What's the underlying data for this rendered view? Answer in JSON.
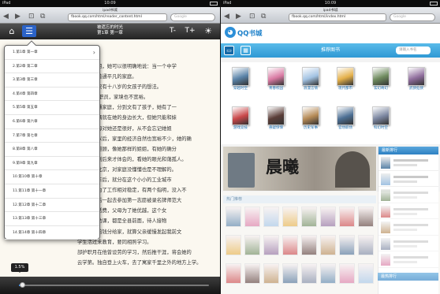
{
  "left": {
    "status": {
      "carrier": "iPad",
      "time": "10:09"
    },
    "browser": {
      "title": "ipad书城",
      "url": "fbook.qq.com/html/reader_content.html",
      "search_placeholder": "Google",
      "back": "◀",
      "forward": "▶",
      "bookmark": "⊡",
      "tabs": "⧉"
    },
    "reader": {
      "book_title": "被遗忘的时光",
      "chapter_title": "第1章 第一章",
      "font_small": "T-",
      "font_large": "T+",
      "progress_label": "1.5%",
      "progress_value": 0.015
    },
    "chapters": [
      "1.第1章 第一章",
      "2.第2章 第二章",
      "3.第3章 第三章",
      "4.第4章 第四章",
      "5.第5章 第五章",
      "6.第6章 第六章",
      "7.第7章 第七章",
      "8.第8章 第八章",
      "9.第9章 第九章",
      "10.第10章 第十章",
      "11.第11章 第十一章",
      "12.第12章 第十二章",
      "13.第13章 第十三章",
      "14.第14章 第十四章"
    ],
    "text_lines": [
      "是我的姐姐，她可以很明确地说：当一个中学",
      "立一个极普通平凡的家庭。",
      "仍是一个只有十八岁的女孩子的想法。",
      "是 名普通职员，家境也不宽裕。",
      "同一个普通家庭，分到文有了孩子，她有了一",
      "来，妹妹俩就在她的身边长大，但她只能和妹",
      "一个，父母对她还是很好，从不会忘记她姐",
      "妹妹出嫁以后，家里的经济自然也宽裕不少，她的确",
      "到更多的照顾，像她那样的姐姐，有她的确分",
      "多年了，到后来才体会的，看她的眼光和蔼孤人。",
      "被遗忘在北京，对家庭没懂懂也是不理解的。",
      "点，四五年后，就分在这个小小的工业城市",
      "不住了，为了工作相对稳定，有两个指明，没入不",
      "高考时过后一起去参加第一志愿被录名牌师范大",
      "学参，生活费，父母为了她优越，这个女",
      "常好多门功课，都是全县前面，待人接物",
      "些我拿到的钱分给家，就算父亲缓慢发起我前文",
      "学生活过来教育，要同相照学习。",
      "部护职月在他曾设劳的学习，然后推干涯，将会她的",
      "云学第。独自登上火车，去了寓家千里之外的地方上学。"
    ]
  },
  "right": {
    "status": {
      "carrier": "iPad",
      "time": "10:09"
    },
    "browser": {
      "title": "ipad书城",
      "url": "fbook.qq.com/html/index.html",
      "search_placeholder": "Google",
      "back": "◀",
      "forward": "▶",
      "bookmark": "⊡",
      "tabs": "⧉"
    },
    "site": {
      "logo": "QQ书城",
      "section": "推荐图书",
      "search_placeholder": "请输入书名"
    },
    "categories": [
      {
        "label": "穿越时空",
        "color": "#5a83a8"
      },
      {
        "label": "青春校园",
        "color": "#d97aa3"
      },
      {
        "label": "浪漫言情",
        "color": "#a3c3e3"
      },
      {
        "label": "现代都市",
        "color": "#e4b04a"
      },
      {
        "label": "玄幻奇幻",
        "color": "#6f8b5f"
      },
      {
        "label": "武侠仙侠",
        "color": "#8f6d9c"
      },
      {
        "label": "游戏竞技",
        "color": "#c9484a"
      },
      {
        "label": "悬疑惊悚",
        "color": "#5b3e39"
      },
      {
        "label": "历史军事",
        "color": "#b58a56"
      },
      {
        "label": "官场职场",
        "color": "#4c6f94"
      },
      {
        "label": "科幻时空",
        "color": "#7b86a0"
      }
    ],
    "banner": {
      "title": "晨曦"
    },
    "hot_title": "热门推荐",
    "sidebar_title": "最新排行",
    "sidebar_title_2": "最热排行",
    "side_rows": 7
  }
}
